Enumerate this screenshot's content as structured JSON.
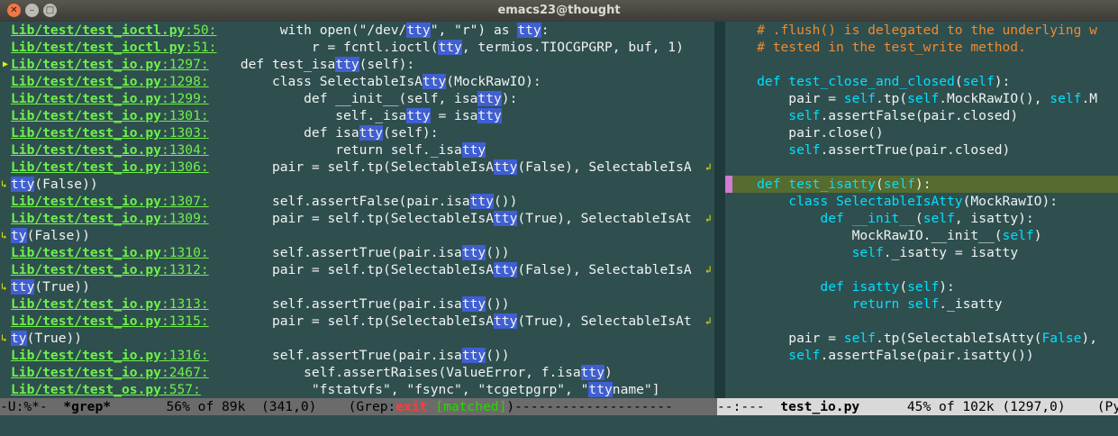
{
  "window": {
    "title": "emacs23@thought",
    "close_glyph": "✕",
    "min_glyph": "–",
    "max_glyph": "□"
  },
  "grep_lines": [
    {
      "file": "Lib/test/test_ioctl.py",
      "line": "50",
      "pre": "        with open(\"/dev/",
      "match": "tty",
      "post": "\", \"r\") as ",
      "match2": "tty",
      "post2": ":"
    },
    {
      "file": "Lib/test/test_ioctl.py",
      "line": "51",
      "pre": "            r = fcntl.ioctl(",
      "match": "tty",
      "post": ", termios.TIOCGPGRP, buf, 1)"
    },
    {
      "file": "Lib/test/test_io.py",
      "line": "1297",
      "pre": "    def test_isa",
      "match": "tty",
      "post": "(self):"
    },
    {
      "file": "Lib/test/test_io.py",
      "line": "1298",
      "pre": "        class SelectableIsA",
      "match": "tty",
      "post": "(MockRawIO):"
    },
    {
      "file": "Lib/test/test_io.py",
      "line": "1299",
      "pre": "            def __init__(self, isa",
      "match": "tty",
      "post": "):"
    },
    {
      "file": "Lib/test/test_io.py",
      "line": "1301",
      "pre": "                self._isa",
      "match": "tty",
      "post": " = isa",
      "match2": "tty",
      "post2": ""
    },
    {
      "file": "Lib/test/test_io.py",
      "line": "1303",
      "pre": "            def isa",
      "match": "tty",
      "post": "(self):"
    },
    {
      "file": "Lib/test/test_io.py",
      "line": "1304",
      "pre": "                return self._isa",
      "match": "tty",
      "post": ""
    },
    {
      "file": "Lib/test/test_io.py",
      "line": "1306",
      "pre": "        pair = self.tp(SelectableIsA",
      "match": "tty",
      "post": "(False), SelectableIsA"
    },
    {
      "wrap": true,
      "match": "tty",
      "post": "(False))"
    },
    {
      "file": "Lib/test/test_io.py",
      "line": "1307",
      "pre": "        self.assertFalse(pair.isa",
      "match": "tty",
      "post": "())"
    },
    {
      "file": "Lib/test/test_io.py",
      "line": "1309",
      "pre": "        pair = self.tp(SelectableIsA",
      "match": "tty",
      "post": "(True), SelectableIsAt"
    },
    {
      "wrap": true,
      "match": "ty",
      "post": "(False))"
    },
    {
      "file": "Lib/test/test_io.py",
      "line": "1310",
      "pre": "        self.assertTrue(pair.isa",
      "match": "tty",
      "post": "())"
    },
    {
      "file": "Lib/test/test_io.py",
      "line": "1312",
      "pre": "        pair = self.tp(SelectableIsA",
      "match": "tty",
      "post": "(False), SelectableIsA"
    },
    {
      "wrap": true,
      "match": "tty",
      "post": "(True))"
    },
    {
      "file": "Lib/test/test_io.py",
      "line": "1313",
      "pre": "        self.assertTrue(pair.isa",
      "match": "tty",
      "post": "())"
    },
    {
      "file": "Lib/test/test_io.py",
      "line": "1315",
      "pre": "        pair = self.tp(SelectableIsA",
      "match": "tty",
      "post": "(True), SelectableIsAt"
    },
    {
      "wrap": true,
      "match": "ty",
      "post": "(True))"
    },
    {
      "file": "Lib/test/test_io.py",
      "line": "1316",
      "pre": "        self.assertTrue(pair.isa",
      "match": "tty",
      "post": "())"
    },
    {
      "file": "Lib/test/test_io.py",
      "line": "2467",
      "pre": "            self.assertRaises(ValueError, f.isa",
      "match": "tty",
      "post": ")"
    },
    {
      "file": "Lib/test/test_os.py",
      "line": "557",
      "pre": "              \"fstatvfs\", \"fsync\", \"tcgetpgrp\", \"",
      "match": "tty",
      "post": "name\"]"
    }
  ],
  "source_lines": [
    [
      {
        "c": "cm",
        "t": "    # .flush() is delegated to the underlying w"
      }
    ],
    [
      {
        "c": "cm",
        "t": "    # tested in the test_write method."
      }
    ],
    [],
    [
      {
        "c": "kw",
        "t": "    def "
      },
      {
        "c": "kw",
        "t": "test_close_and_closed"
      },
      {
        "c": "tx",
        "t": "("
      },
      {
        "c": "kw",
        "t": "self"
      },
      {
        "c": "tx",
        "t": "):"
      }
    ],
    [
      {
        "c": "tx",
        "t": "        pair = "
      },
      {
        "c": "kw",
        "t": "self"
      },
      {
        "c": "tx",
        "t": ".tp("
      },
      {
        "c": "kw",
        "t": "self"
      },
      {
        "c": "tx",
        "t": ".MockRawIO(), "
      },
      {
        "c": "kw",
        "t": "self"
      },
      {
        "c": "tx",
        "t": ".M"
      }
    ],
    [
      {
        "c": "tx",
        "t": "        "
      },
      {
        "c": "kw",
        "t": "self"
      },
      {
        "c": "tx",
        "t": ".assertFalse(pair.closed)"
      }
    ],
    [
      {
        "c": "tx",
        "t": "        pair.close()"
      }
    ],
    [
      {
        "c": "tx",
        "t": "        "
      },
      {
        "c": "kw",
        "t": "self"
      },
      {
        "c": "tx",
        "t": ".assertTrue(pair.closed)"
      }
    ],
    [],
    [
      {
        "c": "kw",
        "t": "    def "
      },
      {
        "c": "kw",
        "t": "test_isatty"
      },
      {
        "c": "tx",
        "t": "("
      },
      {
        "c": "kw",
        "t": "self"
      },
      {
        "c": "tx",
        "t": "):"
      }
    ],
    [
      {
        "c": "kw",
        "t": "        class "
      },
      {
        "c": "kw",
        "t": "SelectableIsAtty"
      },
      {
        "c": "tx",
        "t": "(MockRawIO):"
      }
    ],
    [
      {
        "c": "kw",
        "t": "            def "
      },
      {
        "c": "kw",
        "t": "__init__"
      },
      {
        "c": "tx",
        "t": "("
      },
      {
        "c": "kw",
        "t": "self"
      },
      {
        "c": "tx",
        "t": ", isatty):"
      }
    ],
    [
      {
        "c": "tx",
        "t": "                MockRawIO.__init__("
      },
      {
        "c": "kw",
        "t": "self"
      },
      {
        "c": "tx",
        "t": ")"
      }
    ],
    [
      {
        "c": "tx",
        "t": "                "
      },
      {
        "c": "kw",
        "t": "self"
      },
      {
        "c": "tx",
        "t": "._isatty = isatty"
      }
    ],
    [],
    [
      {
        "c": "kw",
        "t": "            def "
      },
      {
        "c": "kw",
        "t": "isatty"
      },
      {
        "c": "tx",
        "t": "("
      },
      {
        "c": "kw",
        "t": "self"
      },
      {
        "c": "tx",
        "t": "):"
      }
    ],
    [
      {
        "c": "kw",
        "t": "                return "
      },
      {
        "c": "kw",
        "t": "self"
      },
      {
        "c": "tx",
        "t": "._isatty"
      }
    ],
    [],
    [
      {
        "c": "tx",
        "t": "        pair = "
      },
      {
        "c": "kw",
        "t": "self"
      },
      {
        "c": "tx",
        "t": ".tp(SelectableIsAtty("
      },
      {
        "c": "kw",
        "t": "False"
      },
      {
        "c": "tx",
        "t": "),"
      }
    ],
    [
      {
        "c": "tx",
        "t": "        "
      },
      {
        "c": "kw",
        "t": "self"
      },
      {
        "c": "tx",
        "t": ".assertFalse(pair.isatty())"
      }
    ],
    []
  ],
  "highlight_row": 9,
  "modeline_left": {
    "flags": "-U:%*-  ",
    "buffer": "*grep*",
    "pos": "       56% of 89k  (341,0)    (Grep:",
    "exit": "exit",
    "sp": " ",
    "matched": "[matched]",
    "tail": ")--------------------"
  },
  "modeline_right": {
    "flags": "--:---  ",
    "buffer": "test_io.py",
    "pos": "      45% of 102k (1297,0)    (Py"
  }
}
